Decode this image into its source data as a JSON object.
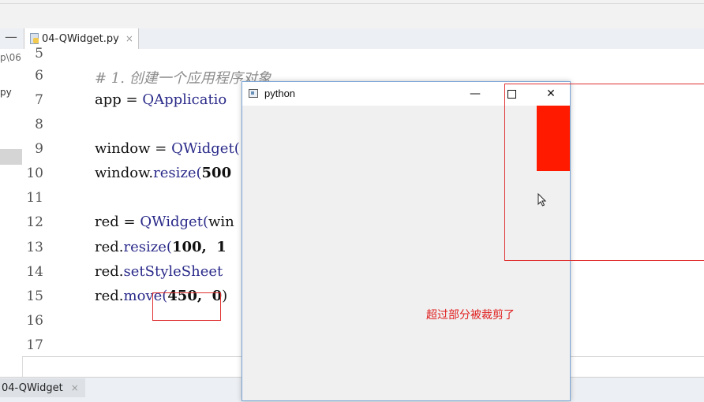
{
  "ide": {
    "minimize_glyph": "—",
    "tab": {
      "label": "04-QWidget.py",
      "close": "×"
    },
    "project": {
      "path_fragment": "p\\06",
      "file_fragment": "py"
    },
    "run_tab": {
      "label": "04-QWidget",
      "close": "×"
    }
  },
  "editor": {
    "line_numbers": [
      "5",
      "6",
      "7",
      "8",
      "9",
      "10",
      "11",
      "12",
      "13",
      "14",
      "15",
      "16",
      "17"
    ],
    "lines": [
      {
        "comment": "# 1. 创建一个应用程序对象"
      },
      {
        "a": "app = ",
        "fn": "QApplicatio"
      },
      {},
      {
        "a": "window = ",
        "fn": "QWidget("
      },
      {
        "a": "window.",
        "fn": "resize(",
        "num": "500"
      },
      {},
      {
        "a": "red = ",
        "fn": "QWidget(",
        "b": "win"
      },
      {
        "a": "red.",
        "fn": "resize(",
        "num": "100,  1"
      },
      {
        "a": "red.",
        "fn": "setStyleSheet"
      },
      {
        "a": "red.",
        "fn": "move(",
        "num": "450,  0",
        "b": ")"
      }
    ]
  },
  "python_window": {
    "title": "python",
    "min_glyph": "—",
    "close_glyph": "✕"
  },
  "annotation": "超过部分被裁剪了",
  "colors": {
    "red_widget": "#ff1a00",
    "annotation": "#e02020"
  }
}
